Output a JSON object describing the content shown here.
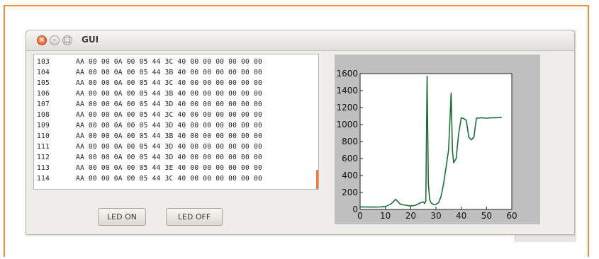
{
  "window": {
    "title": "GUI"
  },
  "log": {
    "rows": [
      {
        "num": "103",
        "bytes": "AA 00 00 0A 00 05 44 3C 40 00 00 00 00 00 00"
      },
      {
        "num": "104",
        "bytes": "AA 00 00 0A 00 05 44 3B 40 00 00 00 00 00 00"
      },
      {
        "num": "105",
        "bytes": "AA 00 00 0A 00 05 44 3C 40 00 00 00 00 00 00"
      },
      {
        "num": "106",
        "bytes": "AA 00 00 0A 00 05 44 3B 40 00 00 00 00 00 00"
      },
      {
        "num": "107",
        "bytes": "AA 00 00 0A 00 05 44 3D 40 00 00 00 00 00 00"
      },
      {
        "num": "108",
        "bytes": "AA 00 00 0A 00 05 44 3C 40 00 00 00 00 00 00"
      },
      {
        "num": "109",
        "bytes": "AA 00 00 0A 00 05 44 3D 40 00 00 00 00 00 00"
      },
      {
        "num": "110",
        "bytes": "AA 00 00 0A 00 05 44 3B 40 00 00 00 00 00 00"
      },
      {
        "num": "111",
        "bytes": "AA 00 00 0A 00 05 44 3D 40 00 00 00 00 00 00"
      },
      {
        "num": "112",
        "bytes": "AA 00 00 0A 00 05 44 3D 40 00 00 00 00 00 00"
      },
      {
        "num": "113",
        "bytes": "AA 00 00 0A 00 05 44 3E 40 00 00 00 00 00 00"
      },
      {
        "num": "114",
        "bytes": "AA 00 00 0A 00 05 44 3C 40 00 00 00 00 00 00"
      }
    ]
  },
  "buttons": {
    "led_on": "LED ON",
    "led_off": "LED OFF"
  },
  "icons": {
    "close": "close-icon",
    "minimize": "minimize-icon",
    "maximize": "maximize-icon"
  },
  "colors": {
    "accent_border": "#f08a3a",
    "line": "#1f6b3a",
    "plot_bg": "#bfbfbf"
  },
  "chart_data": {
    "type": "line",
    "xlim": [
      0,
      60
    ],
    "ylim": [
      0,
      1600
    ],
    "x_ticks": [
      0,
      10,
      20,
      30,
      40,
      50,
      60
    ],
    "y_ticks": [
      0,
      200,
      400,
      600,
      800,
      1000,
      1200,
      1400,
      1600
    ],
    "grid": false,
    "series": [
      {
        "x": [
          0,
          2,
          4,
          6,
          8,
          10,
          12,
          13,
          14,
          15,
          16,
          18,
          20,
          22,
          24,
          25,
          25.5,
          26,
          26.5,
          27,
          27.5,
          28,
          29,
          30,
          31,
          32,
          33,
          34,
          35,
          36,
          36.5,
          37,
          38,
          39,
          40,
          41,
          42,
          43,
          44,
          45,
          46,
          48,
          50,
          52,
          54,
          56
        ],
        "values": [
          30,
          30,
          28,
          28,
          30,
          35,
          60,
          85,
          120,
          90,
          60,
          50,
          40,
          50,
          80,
          90,
          70,
          100,
          1570,
          300,
          120,
          80,
          60,
          60,
          80,
          150,
          300,
          500,
          700,
          1370,
          700,
          550,
          600,
          900,
          1080,
          1070,
          1050,
          850,
          820,
          850,
          1075,
          1080,
          1075,
          1080,
          1080,
          1085
        ]
      }
    ]
  }
}
